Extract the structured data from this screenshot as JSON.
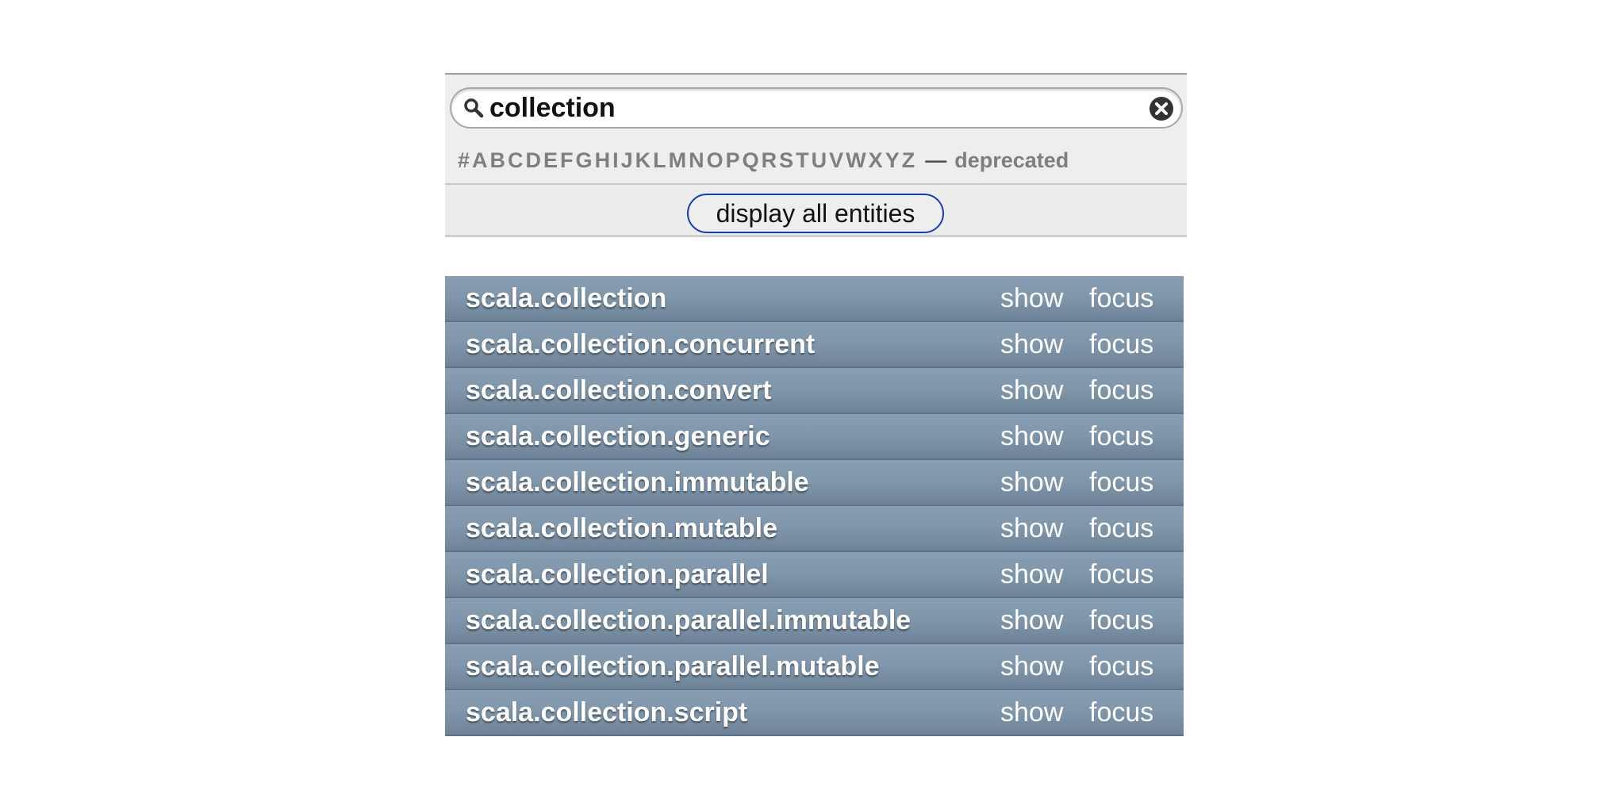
{
  "search": {
    "value": "collection",
    "placeholder": ""
  },
  "letter_index": {
    "letters": [
      "#",
      "A",
      "B",
      "C",
      "D",
      "E",
      "F",
      "G",
      "H",
      "I",
      "J",
      "K",
      "L",
      "M",
      "N",
      "O",
      "P",
      "Q",
      "R",
      "S",
      "T",
      "U",
      "V",
      "W",
      "X",
      "Y",
      "Z"
    ],
    "dash": "—",
    "deprecated": "deprecated"
  },
  "display_all_label": "display all entities",
  "entities": [
    {
      "name": "scala.collection",
      "show": "show",
      "focus": "focus"
    },
    {
      "name": "scala.collection.concurrent",
      "show": "show",
      "focus": "focus"
    },
    {
      "name": "scala.collection.convert",
      "show": "show",
      "focus": "focus"
    },
    {
      "name": "scala.collection.generic",
      "show": "show",
      "focus": "focus"
    },
    {
      "name": "scala.collection.immutable",
      "show": "show",
      "focus": "focus"
    },
    {
      "name": "scala.collection.mutable",
      "show": "show",
      "focus": "focus"
    },
    {
      "name": "scala.collection.parallel",
      "show": "show",
      "focus": "focus"
    },
    {
      "name": "scala.collection.parallel.immutable",
      "show": "show",
      "focus": "focus"
    },
    {
      "name": "scala.collection.parallel.mutable",
      "show": "show",
      "focus": "focus"
    },
    {
      "name": "scala.collection.script",
      "show": "show",
      "focus": "focus"
    }
  ],
  "colors": {
    "row_bg": "#7f95aa",
    "button_border": "#1a3cb8",
    "letter_text": "#7f7f7f"
  }
}
